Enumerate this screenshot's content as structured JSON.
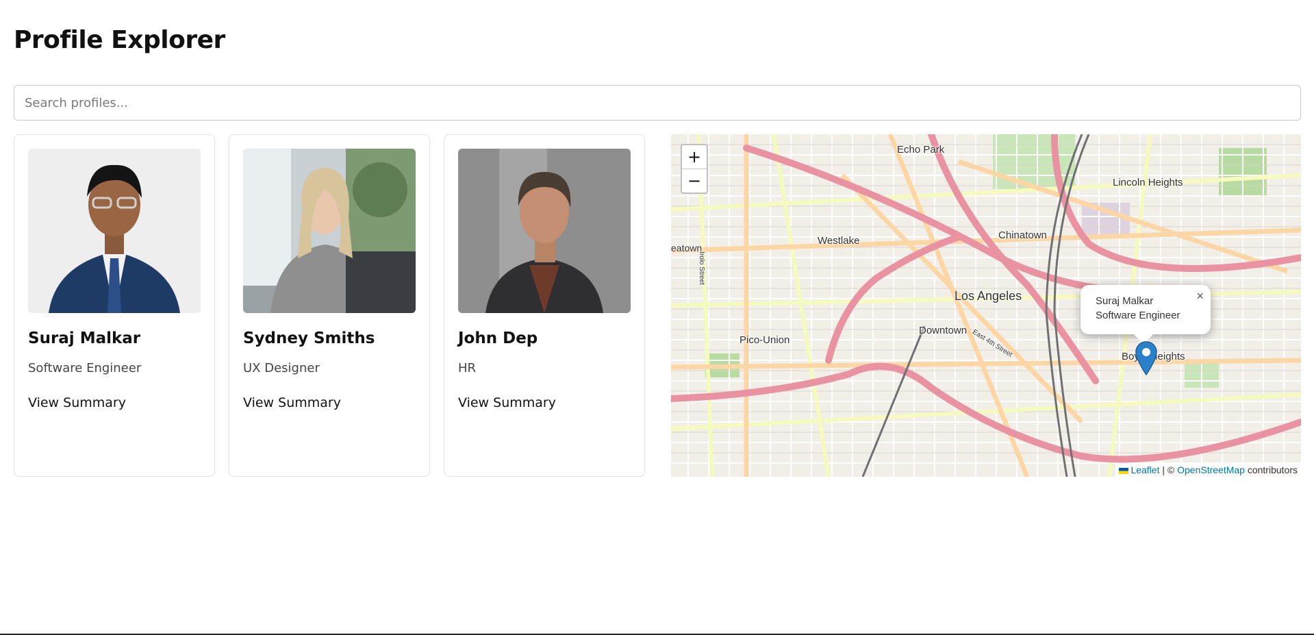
{
  "page": {
    "title": "Profile Explorer"
  },
  "search": {
    "placeholder": "Search profiles..."
  },
  "profiles": [
    {
      "name": "Suraj Malkar",
      "role": "Software Engineer",
      "link": "View Summary"
    },
    {
      "name": "Sydney Smiths",
      "role": "UX Designer",
      "link": "View Summary"
    },
    {
      "name": "John Dep",
      "role": "HR",
      "link": "View Summary"
    }
  ],
  "map": {
    "zoom_in": "+",
    "zoom_out": "−",
    "places": {
      "echo_park": "Echo Park",
      "lincoln_heights": "Lincoln Heights",
      "chinatown": "Chinatown",
      "westlake": "Westlake",
      "los_angeles": "Los Angeles",
      "downtown": "Downtown",
      "pico_union": "Pico-Union",
      "boyle_heights": "Boyle Heights",
      "eatown": "eatown",
      "east_4th": "East 4th Street",
      "irolo": "Irolo Street"
    },
    "popup": {
      "line1": "Suraj Malkar",
      "line2": "Software Engineer",
      "close": "×"
    },
    "attribution": {
      "leaflet": "Leaflet",
      "separator": " | © ",
      "osm": "OpenStreetMap",
      "suffix": " contributors"
    },
    "colors": {
      "motorway": "#e892a2",
      "primary": "#fcd6a4",
      "secondary": "#f7fabf",
      "background": "#f2efe9",
      "marker": "#2a81cb"
    }
  }
}
